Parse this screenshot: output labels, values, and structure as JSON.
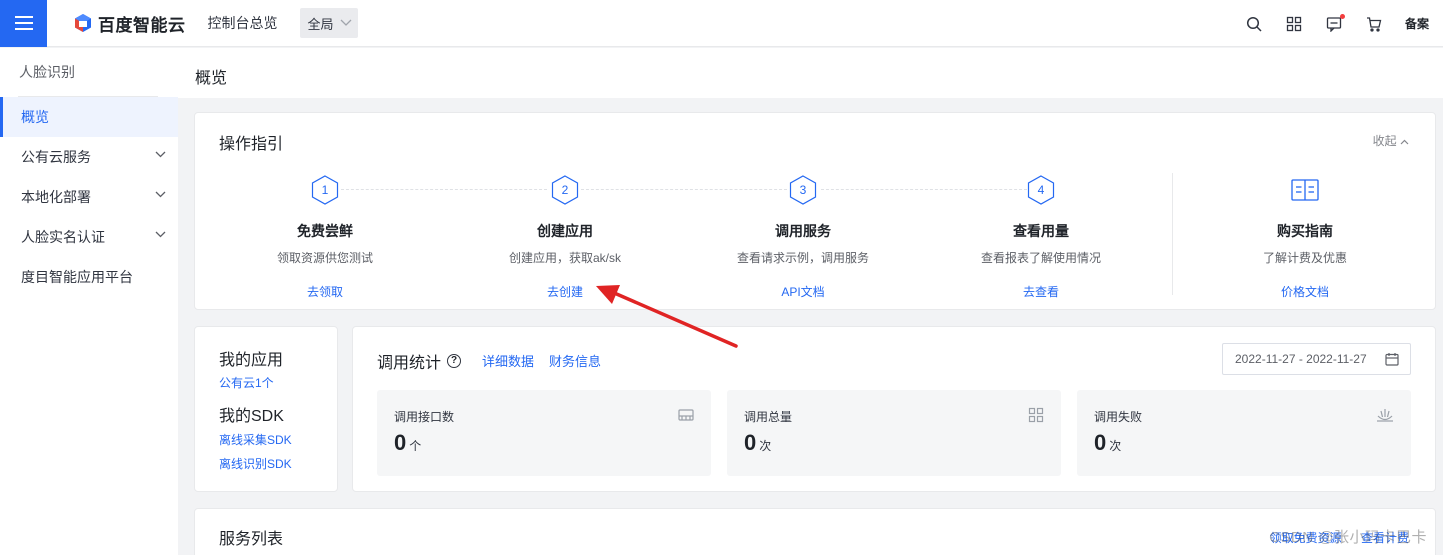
{
  "header": {
    "logo_text": "百度智能云",
    "console_link": "控制台总览",
    "region": "全局",
    "beian": "备案",
    "icons": [
      "search-icon",
      "grid-icon",
      "message-icon",
      "cart-icon"
    ],
    "accent": "#2468f2"
  },
  "sidebar": {
    "title": "人脸识别",
    "items": [
      {
        "label": "概览",
        "active": true
      },
      {
        "label": "公有云服务",
        "expandable": true
      },
      {
        "label": "本地化部署",
        "expandable": true
      },
      {
        "label": "人脸实名认证",
        "expandable": true
      },
      {
        "label": "度目智能应用平台"
      }
    ]
  },
  "page": {
    "title": "概览"
  },
  "guide": {
    "title": "操作指引",
    "collapse_label": "收起",
    "steps": [
      {
        "num": "1",
        "title": "免费尝鲜",
        "desc": "领取资源供您测试",
        "link": "去领取"
      },
      {
        "num": "2",
        "title": "创建应用",
        "desc": "创建应用，获取ak/sk",
        "link": "去创建"
      },
      {
        "num": "3",
        "title": "调用服务",
        "desc": "查看请求示例，调用服务",
        "link": "API文档"
      },
      {
        "num": "4",
        "title": "查看用量",
        "desc": "查看报表了解使用情况",
        "link": "去查看"
      }
    ],
    "buy": {
      "title": "购买指南",
      "desc": "了解计费及优惠",
      "link": "价格文档"
    }
  },
  "my_app": {
    "apps_title": "我的应用",
    "apps_link": "公有云1个",
    "sdk_title": "我的SDK",
    "sdk_links": [
      "离线采集SDK",
      "离线识别SDK"
    ]
  },
  "stats": {
    "title": "调用统计",
    "links": [
      "详细数据",
      "财务信息"
    ],
    "date_range": "2022-11-27 - 2022-11-27",
    "boxes": [
      {
        "label": "调用接口数",
        "value": "0",
        "unit": "个"
      },
      {
        "label": "调用总量",
        "value": "0",
        "unit": "次"
      },
      {
        "label": "调用失败",
        "value": "0",
        "unit": "次"
      }
    ]
  },
  "services": {
    "title": "服务列表",
    "links": [
      "领取免费资源",
      "查看计费"
    ]
  },
  "watermark": "CSDN @张小玛卡巴卡"
}
